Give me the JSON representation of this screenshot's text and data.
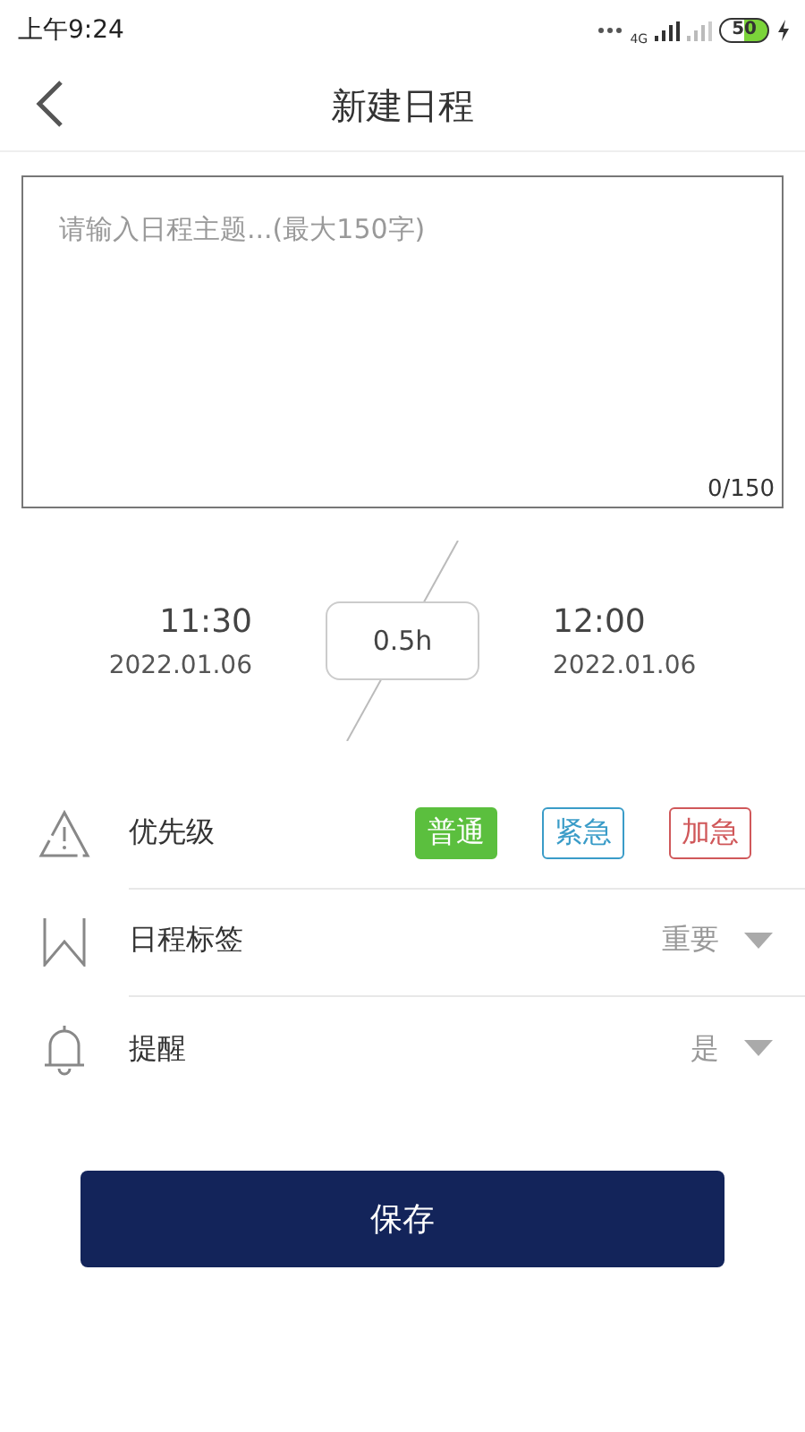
{
  "status_bar": {
    "time": "上午9:24",
    "network": "4G",
    "battery": "50"
  },
  "header": {
    "title": "新建日程"
  },
  "subject": {
    "placeholder": "请输入日程主题...(最大150字)",
    "counter": "0/150"
  },
  "time_range": {
    "start_time": "11:30",
    "start_date": "2022.01.06",
    "duration": "0.5h",
    "end_time": "12:00",
    "end_date": "2022.01.06"
  },
  "priority": {
    "label": "优先级",
    "options": [
      {
        "label": "普通",
        "color": "#5bbf3e",
        "selected": true
      },
      {
        "label": "紧急",
        "color": "#3a9cc8",
        "selected": false
      },
      {
        "label": "加急",
        "color": "#d0585a",
        "selected": false
      }
    ]
  },
  "tag": {
    "label": "日程标签",
    "value": "重要"
  },
  "reminder": {
    "label": "提醒",
    "value": "是"
  },
  "save_button": "保存"
}
